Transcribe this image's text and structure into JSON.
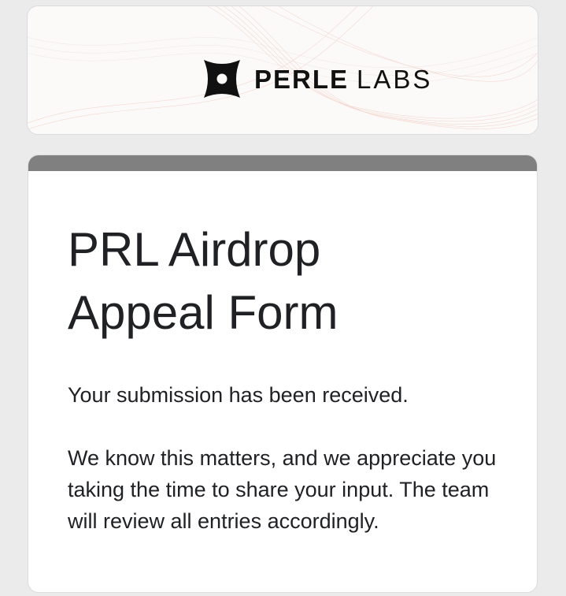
{
  "header": {
    "logo_bold": "PERLE",
    "logo_light": "LABS",
    "logo_icon": "perle-labs-logo-icon"
  },
  "form": {
    "title": "PRL Airdrop Appeal Form",
    "confirmation": "Your submission has been received.",
    "message": "We know this matters, and we appreciate you taking the time to share your input. The team will review all entries accordingly."
  },
  "colors": {
    "background": "#ebebeb",
    "accent_bar": "#808080",
    "card": "#ffffff",
    "text": "#202124"
  }
}
